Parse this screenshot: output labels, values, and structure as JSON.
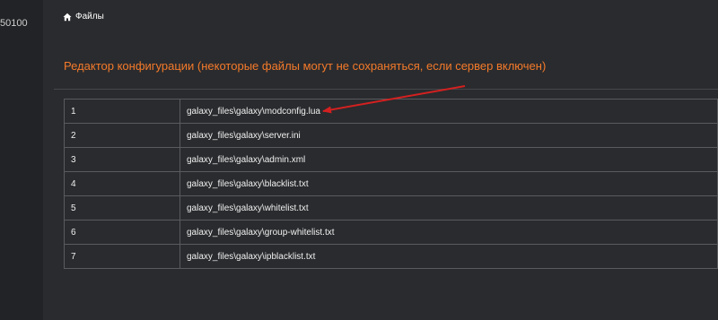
{
  "sidebar": {
    "server_id": "50100"
  },
  "breadcrumb": {
    "icon": "home-icon",
    "label": "Файлы"
  },
  "section_title": "Редактор конфигурации (некоторые файлы могут не сохраняться, если сервер включен)",
  "files": [
    {
      "num": "1",
      "path": "galaxy_files\\galaxy\\modconfig.lua"
    },
    {
      "num": "2",
      "path": "galaxy_files\\galaxy\\server.ini"
    },
    {
      "num": "3",
      "path": "galaxy_files\\galaxy\\admin.xml"
    },
    {
      "num": "4",
      "path": "galaxy_files\\galaxy\\blacklist.txt"
    },
    {
      "num": "5",
      "path": "galaxy_files\\galaxy\\whitelist.txt"
    },
    {
      "num": "6",
      "path": "galaxy_files\\galaxy\\group-whitelist.txt"
    },
    {
      "num": "7",
      "path": "galaxy_files\\galaxy\\ipblacklist.txt"
    }
  ],
  "colors": {
    "accent": "#f47a2a",
    "annotation_arrow": "#d42020",
    "background": "#2a2b2e",
    "sidebar": "#222326"
  }
}
